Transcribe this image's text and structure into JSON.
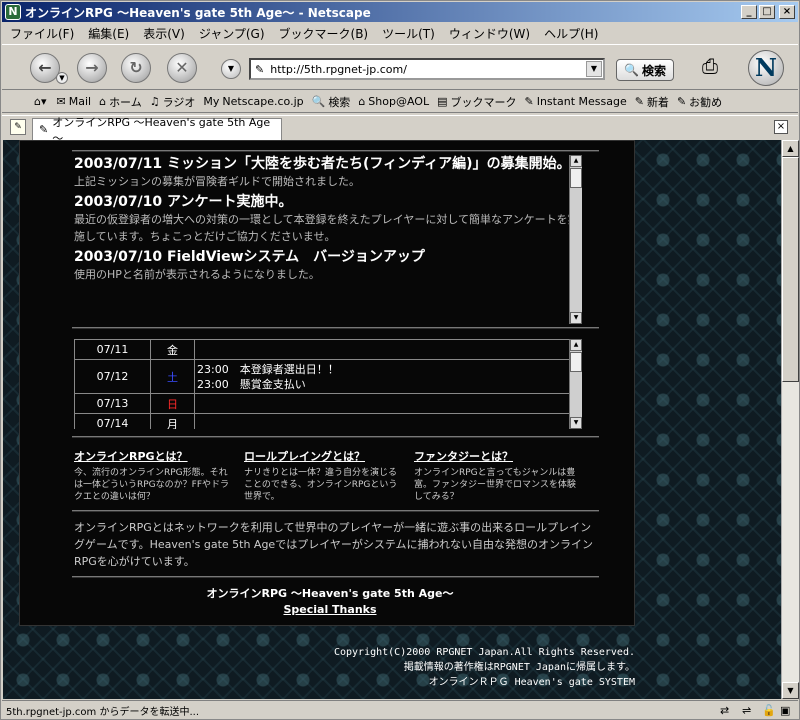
{
  "window": {
    "title": "オンラインRPG ～Heaven's gate 5th Age～ - Netscape",
    "min": "_",
    "max": "□",
    "close": "×"
  },
  "menu": [
    "ファイル(F)",
    "編集(E)",
    "表示(V)",
    "ジャンプ(G)",
    "ブックマーク(B)",
    "ツール(T)",
    "ウィンドウ(W)",
    "ヘルプ(H)"
  ],
  "nav": {
    "back": "←",
    "forward": "→",
    "reload": "↻",
    "stop": "✕",
    "url": "http://5th.rpgnet-jp.com/",
    "search": "検索"
  },
  "personal": [
    {
      "icon": "✉",
      "label": "Mail"
    },
    {
      "icon": "⌂",
      "label": "ホーム"
    },
    {
      "icon": "♫",
      "label": "ラジオ"
    },
    {
      "icon": "My",
      "label": "Netscape.co.jp"
    },
    {
      "icon": "🔍",
      "label": "検索"
    },
    {
      "icon": "⌂",
      "label": "Shop@AOL"
    },
    {
      "icon": "▤",
      "label": "ブックマーク"
    },
    {
      "icon": "✎",
      "label": "Instant Message"
    },
    {
      "icon": "✎",
      "label": "新着"
    },
    {
      "icon": "✎",
      "label": "お勧め"
    }
  ],
  "tab": {
    "title": "オンラインRPG ～Heaven's gate 5th Age～"
  },
  "news": [
    {
      "head": "2003/07/11 ミッション「大陸を歩む者たち(フィンディア編)」の募集開始。",
      "body": "上記ミッションの募集が冒険者ギルドで開始されました。"
    },
    {
      "head": "2003/07/10 アンケート実施中。",
      "body": "最近の仮登録者の増大への対策の一環として本登録を終えたプレイヤーに対して簡単なアンケートを実施しています。ちょこっとだけご協力くださいませ。"
    },
    {
      "head": "2003/07/10 FieldViewシステム　バージョンアップ",
      "body": "使用のHPと名前が表示されるようになりました。"
    }
  ],
  "schedule": [
    {
      "date": "07/11",
      "dow": "金",
      "dow_color": "#ffffff",
      "events": ""
    },
    {
      "date": "07/12",
      "dow": "土",
      "dow_color": "#3a4cff",
      "events": "23:00　本登録者選出日！！\n23:00　懸賞金支払い"
    },
    {
      "date": "07/13",
      "dow": "日",
      "dow_color": "#ff2a2a",
      "events": ""
    },
    {
      "date": "07/14",
      "dow": "月",
      "dow_color": "#ffffff",
      "events": ""
    }
  ],
  "faq": [
    {
      "title": "オンラインRPGとは？",
      "body": "今、流行のオンラインRPG形態。それは一体どういうRPGなのか？FFやドラクエとの違いは何？"
    },
    {
      "title": "ロールプレイングとは？",
      "body": "ナリきりとは一体？違う自分を演じることのできる、オンラインRPGという世界で。"
    },
    {
      "title": "ファンタジーとは？",
      "body": "オンラインRPGと言ってもジャンルは豊富。ファンタジー世界でロマンスを体験してみる？"
    }
  ],
  "intro": "オンラインRPGとはネットワークを利用して世界中のプレイヤーが一緒に遊ぶ事の出来るロールプレイングゲームです。Heaven's gate 5th Ageではプレイヤーがシステムに捕われない自由な発想のオンラインRPGを心がけています。",
  "footer": {
    "title": "オンラインRPG ～Heaven's gate 5th Age～",
    "link": "Special Thanks"
  },
  "copyright": [
    "Copyright(C)2000 RPGNET Japan.All Rights Reserved.",
    "掲載情報の著作権はRPGNET Japanに帰属します。",
    "オンラインＲＰＧ Heaven's gate SYSTEM"
  ],
  "status": "5th.rpgnet-jp.com からデータを転送中..."
}
